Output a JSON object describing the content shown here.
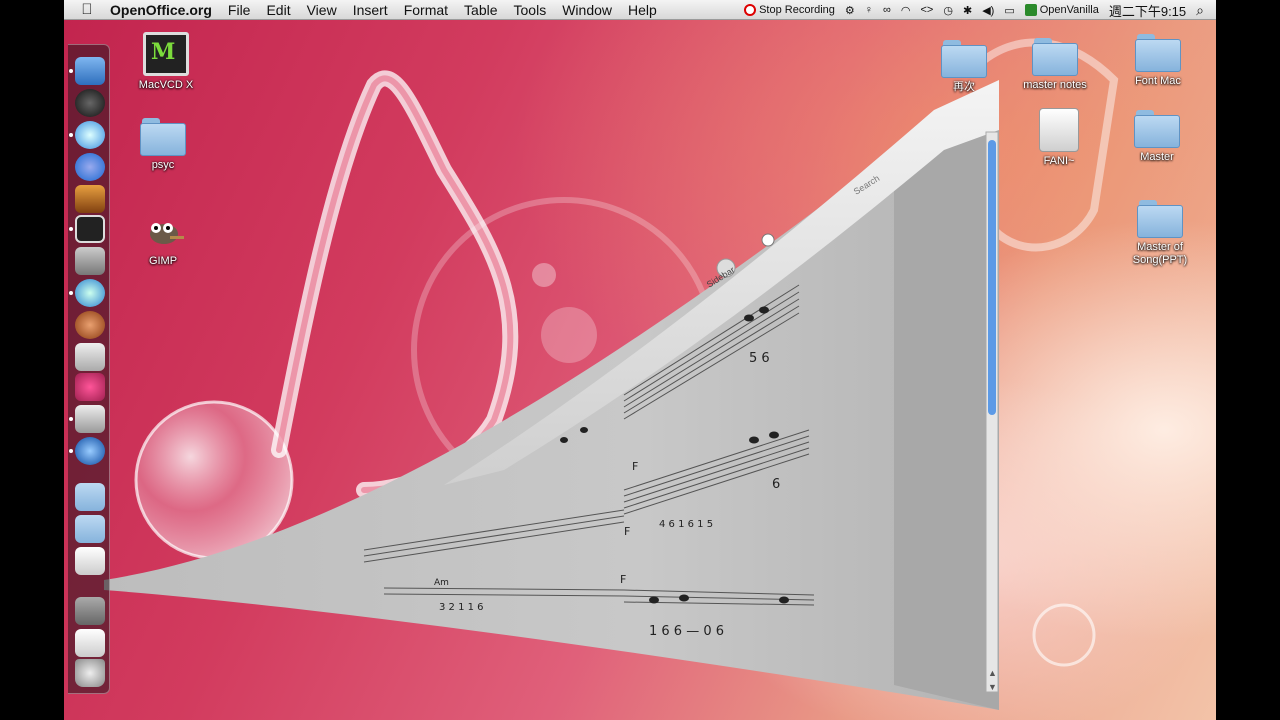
{
  "menubar": {
    "app_name": "OpenOffice.org",
    "menus": [
      "File",
      "Edit",
      "View",
      "Insert",
      "Format",
      "Table",
      "Tools",
      "Window",
      "Help"
    ],
    "stop_recording": "Stop Recording",
    "input_method": "OpenVanilla",
    "clock": "週二下午9:15"
  },
  "desktop_icons": {
    "macvcd": "MacVCD X",
    "psyc": "psyc",
    "gimp": "GIMP",
    "folder_partial": "再次",
    "master_notes": "master notes",
    "font_mac": "Font Mac",
    "fani": "FANI~",
    "master": "Master",
    "master_of_song": "Master of Song(PPT)"
  },
  "document": {
    "sidebar_label": "Sidebar",
    "search_placeholder": "Search",
    "chord_labels": [
      "F",
      "F",
      "Am",
      "F"
    ],
    "numbered_notes": [
      "5 6",
      "6",
      "1 6 6 — 0 6",
      "4 6 1 6 1 5",
      "3 2 1 1 6"
    ]
  },
  "colors": {
    "accent_recording": "#dd0000",
    "desktop_pink": "#c2244e",
    "desktop_peach": "#f3c3a8"
  }
}
